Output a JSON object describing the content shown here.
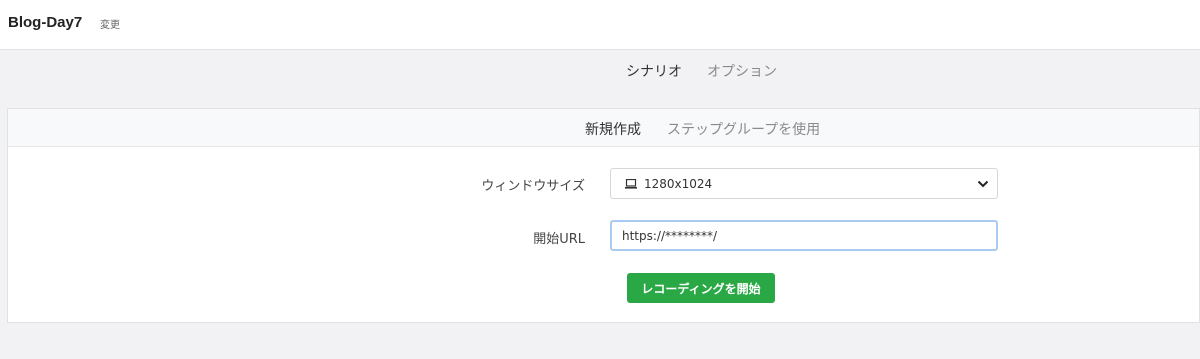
{
  "header": {
    "title": "Blog-Day7",
    "change_label": "変更"
  },
  "main_tabs": [
    {
      "label": "シナリオ",
      "active": true
    },
    {
      "label": "オプション",
      "active": false
    }
  ],
  "sub_tabs": [
    {
      "label": "新規作成",
      "active": true
    },
    {
      "label": "ステップグループを使用",
      "active": false
    }
  ],
  "form": {
    "window_size_label": "ウィンドウサイズ",
    "window_size_value": "1280x1024",
    "window_size_icon": "laptop-icon",
    "start_url_label": "開始URL",
    "start_url_value": "https://********/"
  },
  "actions": {
    "start_recording_label": "レコーディングを開始"
  },
  "colors": {
    "primary_button": "#2aa845",
    "input_focus_border": "#a9cbef"
  }
}
